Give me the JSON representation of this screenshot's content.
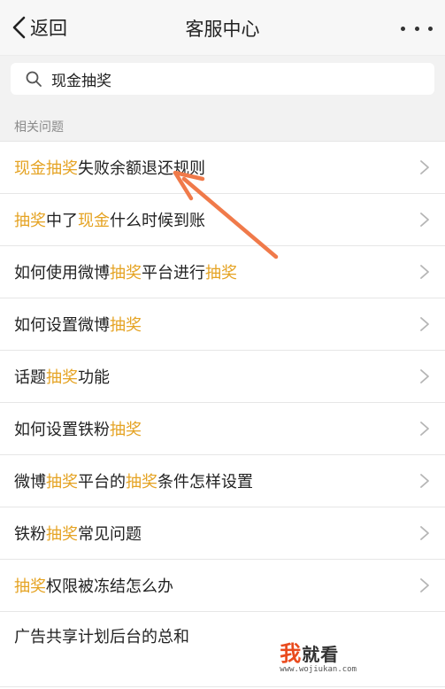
{
  "header": {
    "back_label": "返回",
    "title": "客服中心"
  },
  "search": {
    "query": "现金抽奖"
  },
  "section_label": "相关问题",
  "items": [
    {
      "parts": [
        {
          "t": "现金抽奖",
          "hl": true
        },
        {
          "t": "失败余额退还规则"
        }
      ]
    },
    {
      "parts": [
        {
          "t": "抽奖",
          "hl": true
        },
        {
          "t": "中了"
        },
        {
          "t": "现金",
          "hl": true
        },
        {
          "t": "什么时候到账"
        }
      ]
    },
    {
      "parts": [
        {
          "t": "如何使用微博"
        },
        {
          "t": "抽奖",
          "hl": true
        },
        {
          "t": "平台进行"
        },
        {
          "t": "抽奖",
          "hl": true
        }
      ]
    },
    {
      "parts": [
        {
          "t": "如何设置微博"
        },
        {
          "t": "抽奖",
          "hl": true
        }
      ]
    },
    {
      "parts": [
        {
          "t": "话题"
        },
        {
          "t": "抽奖",
          "hl": true
        },
        {
          "t": "功能"
        }
      ]
    },
    {
      "parts": [
        {
          "t": "如何设置铁粉"
        },
        {
          "t": "抽奖",
          "hl": true
        }
      ]
    },
    {
      "parts": [
        {
          "t": "微博"
        },
        {
          "t": "抽奖",
          "hl": true
        },
        {
          "t": "平台的"
        },
        {
          "t": "抽奖",
          "hl": true
        },
        {
          "t": "条件怎样设置"
        }
      ]
    },
    {
      "parts": [
        {
          "t": "铁粉"
        },
        {
          "t": "抽奖",
          "hl": true
        },
        {
          "t": "常见问题"
        }
      ]
    },
    {
      "parts": [
        {
          "t": "抽奖",
          "hl": true
        },
        {
          "t": "权限被冻结怎么办"
        }
      ]
    },
    {
      "parts": [
        {
          "t": "广告共享计划后台的总和"
        }
      ]
    }
  ],
  "watermark": {
    "accent": "我",
    "text": "就看",
    "url": "www.wojiukan.com"
  },
  "colors": {
    "highlight": "#e5a323",
    "annotation_arrow": "#f07a4a"
  }
}
